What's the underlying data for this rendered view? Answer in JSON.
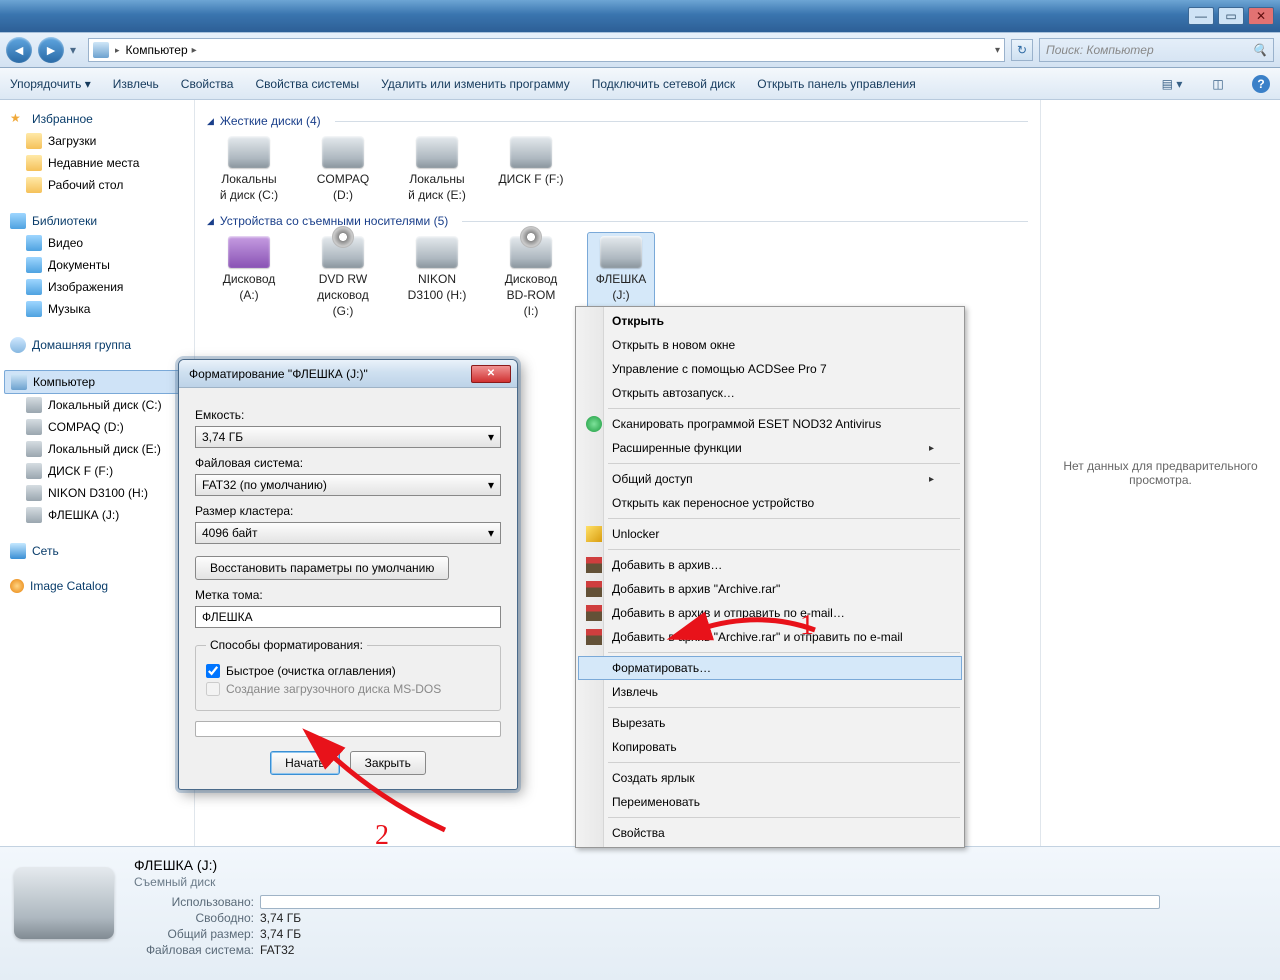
{
  "titlebar": {
    "min": "—",
    "max": "▭",
    "close": "✕"
  },
  "nav": {
    "back": "◄",
    "fwd": "►",
    "breadcrumb": [
      "Компьютер"
    ],
    "search_placeholder": "Поиск: Компьютер"
  },
  "toolbar": {
    "organize": "Упорядочить ▾",
    "items": [
      "Извлечь",
      "Свойства",
      "Свойства системы",
      "Удалить или изменить программу",
      "Подключить сетевой диск",
      "Открыть панель управления"
    ]
  },
  "sidebar": {
    "favorites": {
      "head": "Избранное",
      "items": [
        "Загрузки",
        "Недавние места",
        "Рабочий стол"
      ]
    },
    "libraries": {
      "head": "Библиотеки",
      "items": [
        "Видео",
        "Документы",
        "Изображения",
        "Музыка"
      ]
    },
    "homegroup": "Домашняя группа",
    "computer": {
      "head": "Компьютер",
      "items": [
        "Локальный диск (C:)",
        "COMPAQ (D:)",
        "Локальный диск (E:)",
        "ДИСК F (F:)",
        "NIKON D3100 (H:)",
        "ФЛЕШКА (J:)"
      ]
    },
    "network": "Сеть",
    "catalog": "Image Catalog"
  },
  "content": {
    "hdd_head": "Жесткие диски (4)",
    "hdd": [
      {
        "l1": "Локальны",
        "l2": "й диск (C:)"
      },
      {
        "l1": "COMPAQ",
        "l2": "(D:)"
      },
      {
        "l1": "Локальны",
        "l2": "й диск (E:)"
      },
      {
        "l1": "ДИСК F (F:)",
        "l2": ""
      }
    ],
    "rem_head": "Устройства со съемными носителями (5)",
    "rem": [
      {
        "l1": "Дисковод",
        "l2": "(A:)"
      },
      {
        "l1": "DVD RW",
        "l2": "дисковод",
        "l3": "(G:)"
      },
      {
        "l1": "NIKON",
        "l2": "D3100 (H:)"
      },
      {
        "l1": "Дисковод",
        "l2": "BD-ROM",
        "l3": "(I:)"
      },
      {
        "l1": "ФЛЕШКА",
        "l2": "(J:)"
      }
    ]
  },
  "preview": {
    "empty": "Нет данных для предварительного просмотра."
  },
  "details": {
    "title": "ФЛЕШКА (J:)",
    "subtitle": "Съемный диск",
    "used_label": "Использовано:",
    "free_label": "Свободно:",
    "free": "3,74 ГБ",
    "total_label": "Общий размер:",
    "total": "3,74 ГБ",
    "fs_label": "Файловая система:",
    "fs": "FAT32"
  },
  "ctx": {
    "open": "Открыть",
    "open_new": "Открыть в новом окне",
    "acdsee": "Управление с помощью ACDSee Pro 7",
    "autoplay": "Открыть автозапуск…",
    "eset": "Сканировать программой ESET NOD32 Antivirus",
    "adv": "Расширенные функции",
    "share": "Общий доступ",
    "portable": "Открыть как переносное устройство",
    "unlocker": "Unlocker",
    "rar1": "Добавить в архив…",
    "rar2": "Добавить в архив \"Archive.rar\"",
    "rar3": "Добавить в архив и отправить по e-mail…",
    "rar4": "Добавить в архив \"Archive.rar\" и отправить по e-mail",
    "format": "Форматировать…",
    "eject": "Извлечь",
    "cut": "Вырезать",
    "copy": "Копировать",
    "shortcut": "Создать ярлык",
    "rename": "Переименовать",
    "props": "Свойства"
  },
  "dialog": {
    "title": "Форматирование \"ФЛЕШКА (J:)\"",
    "capacity_label": "Емкость:",
    "capacity": "3,74 ГБ",
    "fs_label": "Файловая система:",
    "fs": "FAT32 (по умолчанию)",
    "cluster_label": "Размер кластера:",
    "cluster": "4096 байт",
    "restore": "Восстановить параметры по умолчанию",
    "volume_label": "Метка тома:",
    "volume": "ФЛЕШКА",
    "methods_label": "Способы форматирования:",
    "quick": "Быстрое (очистка оглавления)",
    "bootdisk": "Создание загрузочного диска MS-DOS",
    "start": "Начать",
    "close": "Закрыть"
  },
  "annot": {
    "one": "1",
    "two": "2"
  }
}
